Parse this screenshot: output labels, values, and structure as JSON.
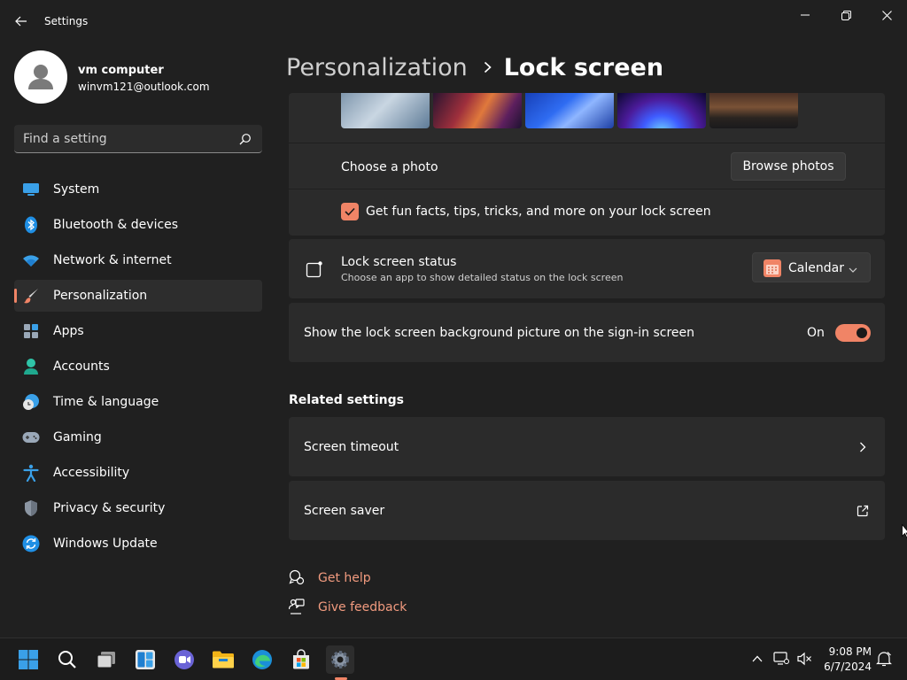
{
  "app": {
    "title": "Settings"
  },
  "profile": {
    "name": "vm computer",
    "email": "winvm121@outlook.com"
  },
  "search": {
    "placeholder": "Find a setting"
  },
  "nav": {
    "items": [
      {
        "label": "System",
        "icon": "system-icon"
      },
      {
        "label": "Bluetooth & devices",
        "icon": "bluetooth-icon"
      },
      {
        "label": "Network & internet",
        "icon": "wifi-icon"
      },
      {
        "label": "Personalization",
        "icon": "brush-icon",
        "selected": true
      },
      {
        "label": "Apps",
        "icon": "apps-icon"
      },
      {
        "label": "Accounts",
        "icon": "person-icon"
      },
      {
        "label": "Time & language",
        "icon": "clock-globe-icon"
      },
      {
        "label": "Gaming",
        "icon": "gamepad-icon"
      },
      {
        "label": "Accessibility",
        "icon": "accessibility-icon"
      },
      {
        "label": "Privacy & security",
        "icon": "shield-icon"
      },
      {
        "label": "Windows Update",
        "icon": "update-icon"
      }
    ]
  },
  "header": {
    "parent": "Personalization",
    "current": "Lock screen"
  },
  "lock_screen": {
    "choose_photo_label": "Choose a photo",
    "browse_button": "Browse photos",
    "fun_facts_label": "Get fun facts, tips, tricks, and more on your lock screen",
    "fun_facts_checked": true,
    "status_title": "Lock screen status",
    "status_desc": "Choose an app to show detailed status on the lock screen",
    "status_value": "Calendar",
    "signin_label": "Show the lock screen background picture on the sign-in screen",
    "signin_state": "On",
    "signin_on": true
  },
  "related": {
    "title": "Related settings",
    "items": [
      {
        "label": "Screen timeout",
        "icon": "chevron-right-icon"
      },
      {
        "label": "Screen saver",
        "icon": "external-link-icon"
      }
    ]
  },
  "help": {
    "get_help": "Get help",
    "give_feedback": "Give feedback"
  },
  "taskbar": {
    "icons": [
      "start-icon",
      "search-icon",
      "task-view-icon",
      "widgets-icon",
      "teams-chat-icon",
      "file-explorer-icon",
      "edge-icon",
      "store-icon",
      "settings-icon"
    ],
    "time": "9:08 PM",
    "date": "6/7/2024"
  },
  "colors": {
    "accent": "#f08466",
    "background": "#202020",
    "card": "#2b2b2b"
  }
}
